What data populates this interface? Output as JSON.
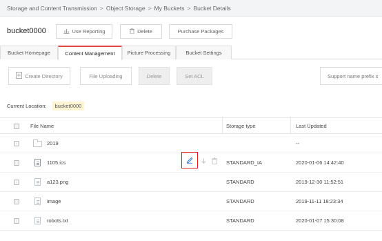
{
  "breadcrumb": [
    "Storage and Content Transmission",
    "Object Storage",
    "My Buckets",
    "Bucket Details"
  ],
  "breadcrumb_separator": ">",
  "bucket": {
    "name": "bucket0000",
    "use_reporting_label": "Use Reporting",
    "delete_label": "Delete",
    "purchase_label": "Purchase Packages"
  },
  "tabs": [
    {
      "label": "Bucket Homepage",
      "active": false
    },
    {
      "label": "Content Management",
      "active": true
    },
    {
      "label": "Picture Processing",
      "active": false
    },
    {
      "label": "Bucket Settings",
      "active": false
    }
  ],
  "toolbar": {
    "create_directory_label": "Create Directory",
    "file_uploading_label": "File Uploading",
    "delete_label": "Delete",
    "set_acl_label": "Set ACL",
    "search_placeholder": "Support name prefix s"
  },
  "location": {
    "label": "Current Location:",
    "value": "bucket0000"
  },
  "table": {
    "columns": [
      "File Name",
      "Storage type",
      "Last Updated"
    ],
    "rows": [
      {
        "name": "2019",
        "type": "",
        "updated": "--",
        "kind": "folder"
      },
      {
        "name": "1105.ics",
        "type": "STANDARD_IA",
        "updated": "2020-01-06 14:42:40",
        "kind": "file"
      },
      {
        "name": "a123.png",
        "type": "STANDARD",
        "updated": "2019-12-30 11:52:51",
        "kind": "file"
      },
      {
        "name": "image",
        "type": "STANDARD",
        "updated": "2019-11-11 18:23:34",
        "kind": "file"
      },
      {
        "name": "robots.txt",
        "type": "STANDARD",
        "updated": "2020-01-07 15:30:08",
        "kind": "file"
      }
    ]
  },
  "colors": {
    "active_tab_accent": "#e64545",
    "highlight_box": "#e02020",
    "edit_icon": "#3a78d8",
    "location_chip": "#fdf4d4"
  },
  "icons": {
    "edit": "pencil-icon",
    "download": "download-icon",
    "delete": "trash-icon"
  }
}
